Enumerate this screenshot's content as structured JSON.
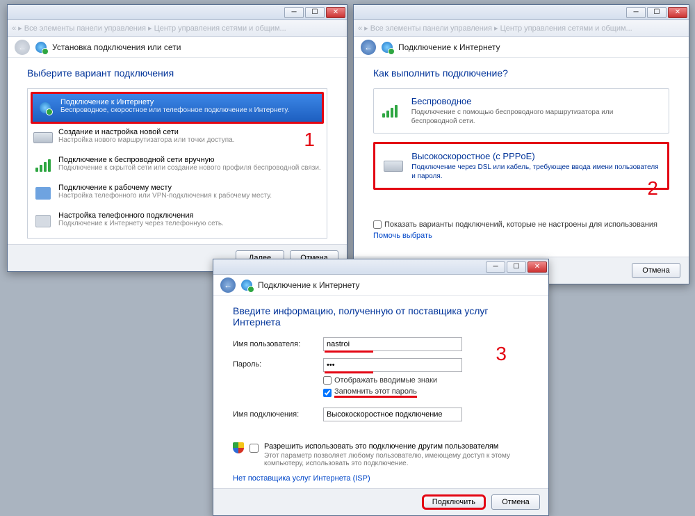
{
  "step_labels": {
    "s1": "1",
    "s2": "2",
    "s3": "3"
  },
  "win1": {
    "header": "Установка подключения или сети",
    "heading": "Выберите вариант подключения",
    "options": [
      {
        "t1": "Подключение к Интернету",
        "t2": "Беспроводное, скоростное или телефонное подключение к Интернету."
      },
      {
        "t1": "Создание и настройка новой сети",
        "t2": "Настройка нового маршрутизатора или точки доступа."
      },
      {
        "t1": "Подключение к беспроводной сети вручную",
        "t2": "Подключение к скрытой сети или создание нового профиля беспроводной связи."
      },
      {
        "t1": "Подключение к рабочему месту",
        "t2": "Настройка телефонного или VPN-подключения к рабочему месту."
      },
      {
        "t1": "Настройка телефонного подключения",
        "t2": "Подключение к Интернету через телефонную сеть."
      }
    ],
    "btn_next": "Далее",
    "btn_cancel": "Отмена"
  },
  "win2": {
    "header": "Подключение к Интернету",
    "heading": "Как выполнить подключение?",
    "opt_wireless": {
      "t1": "Беспроводное",
      "t2": "Подключение с помощью беспроводного маршрутизатора или беспроводной сети."
    },
    "opt_pppoe": {
      "t1": "Высокоскоростное (с PPPoE)",
      "t2": "Подключение через DSL или кабель, требующее ввода имени пользователя и пароля."
    },
    "chk_show": "Показать варианты подключений, которые не настроены для использования",
    "help_link": "Помочь выбрать",
    "btn_cancel": "Отмена"
  },
  "win3": {
    "header": "Подключение к Интернету",
    "heading": "Введите информацию, полученную от поставщика услуг Интернета",
    "lbl_user": "Имя пользователя:",
    "val_user": "nastroi",
    "lbl_pass": "Пароль:",
    "val_pass": "•••",
    "chk_show_chars": "Отображать вводимые знаки",
    "chk_remember": "Запомнить этот пароль",
    "lbl_conn": "Имя подключения:",
    "val_conn": "Высокоскоростное подключение",
    "chk_allow": "Разрешить использовать это подключение другим пользователям",
    "txt_allow_desc": "Этот параметр позволяет любому пользователю, имеющему доступ к этому компьютеру, использовать это подключение.",
    "link_isp": "Нет поставщика услуг Интернета (ISP)",
    "btn_connect": "Подключить",
    "btn_cancel": "Отмена"
  }
}
